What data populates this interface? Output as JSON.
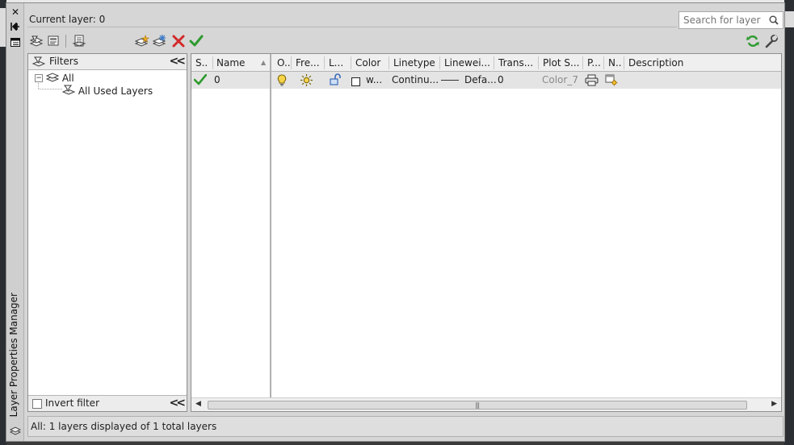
{
  "palette": {
    "title": "Layer Properties Manager",
    "colors": {
      "frame": "#d6d6d6",
      "row_selected": "#e4e4e4",
      "check_green": "#2e9a2e",
      "delete_red": "#d22a2a",
      "lamp_yellow": "#f0c020"
    }
  },
  "header": {
    "current_layer": "Current layer: 0",
    "search_placeholder": "Search for layer"
  },
  "toolbar": {
    "left_icons": [
      "new-property-filter-icon",
      "new-group-filter-icon",
      "layer-states-manager-icon"
    ],
    "mid_icons": [
      "new-layer-icon",
      "new-layer-vp-frozen-icon",
      "delete-layer-icon",
      "set-current-icon"
    ],
    "right_icons": [
      "refresh-icon",
      "settings-wrench-icon"
    ]
  },
  "filters": {
    "header": "Filters",
    "tree": [
      {
        "label": "All",
        "expanded": true
      },
      {
        "label": "All Used Layers"
      }
    ],
    "invert_filter": "Invert filter",
    "invert_checked": false
  },
  "grid": {
    "columns": [
      "S..",
      "Name",
      "O..",
      "Fre...",
      "L...",
      "Color",
      "Linetype",
      "Linewei...",
      "Trans...",
      "Plot S...",
      "P...",
      "N..",
      "Description"
    ],
    "rows": [
      {
        "status": "current-check-icon",
        "name": "0",
        "on": "lightbulb-on-icon",
        "freeze": "sun-thawed-icon",
        "lock": "unlocked-padlock-icon",
        "color": "w...",
        "linetype": "Continu...",
        "lineweight": "Defa...",
        "transparency": "0",
        "plot_style": "Color_7",
        "plot": "printer-icon",
        "new_vp_freeze": "new-vp-freeze-icon",
        "description": ""
      }
    ]
  },
  "status": {
    "text": "All: 1 layers displayed of 1 total layers"
  }
}
